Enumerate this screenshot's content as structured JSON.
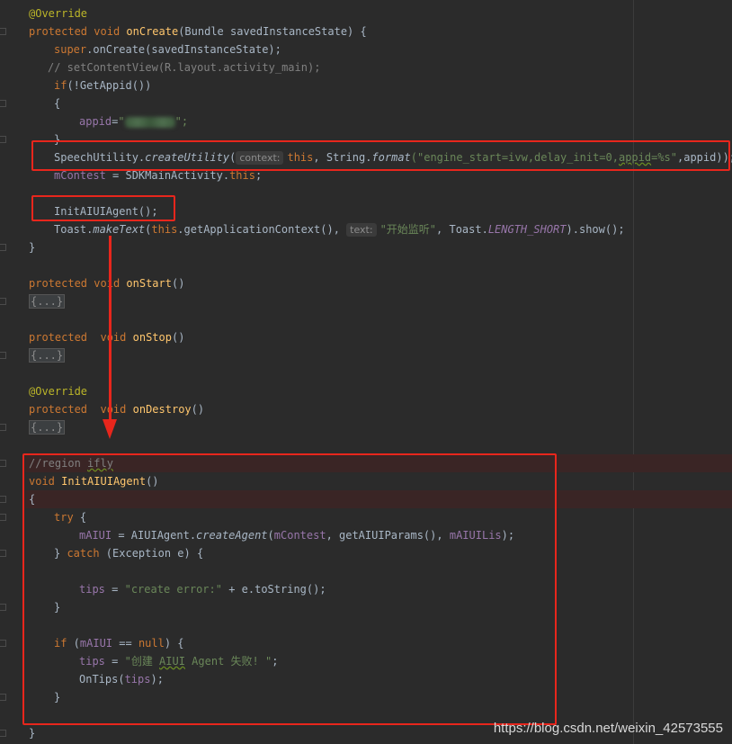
{
  "code_lines": {
    "l1_override": "@Override",
    "l2_protected": "protected",
    "l2_void": "void",
    "l2_method": "onCreate",
    "l2_rest": "(Bundle savedInstanceState) {",
    "l3_super": "super",
    "l3_rest": ".onCreate(savedInstanceState);",
    "l4_comment": "// setContentView(R.layout.activity_main);",
    "l5_if": "if",
    "l5_rest": "(!GetAppid())",
    "l6_brace": "{",
    "l7_field": "appid",
    "l7_eq": "=",
    "l7_q1": "\"",
    "l7_q2": "\";",
    "l8_brace": "}",
    "l9_class": "SpeechUtility.",
    "l9_method": "createUtility",
    "l9_paren": "(",
    "l9_hint": "context:",
    "l9_this": "this",
    "l9_comma": ", String.",
    "l9_format": "format",
    "l9_str_a": "(\"engine_start=ivw,delay_init=0,",
    "l9_str_squig": "appid",
    "l9_str_b": "=%s\"",
    "l9_end": ",appid));",
    "l10_field": "mContest",
    "l10_mid": " = SDKMainActivity.",
    "l10_this": "this",
    "l10_end": ";",
    "l12_call": "InitAIUIAgent();",
    "l13_toast": "Toast.",
    "l13_make": "makeText",
    "l13_paren": "(",
    "l13_this": "this",
    "l13_ctx": ".getApplicationContext(), ",
    "l13_hint": "text:",
    "l13_str": "\"开始监听\"",
    "l13_comma": ", Toast.",
    "l13_const": "LENGTH_SHORT",
    "l13_end": ").show();",
    "l14_brace": "}",
    "l16_protected": "protected",
    "l16_void": "void",
    "l16_method": "onStart",
    "l16_rest": "()",
    "l17_collapsed": "{...}",
    "l19_protected": "protected",
    "l19_void": "void",
    "l19_method": "onStop",
    "l19_rest": "()",
    "l20_collapsed": "{...}",
    "l22_override": "@Override",
    "l23_protected": "protected",
    "l23_void": "void",
    "l23_method": "onDestroy",
    "l23_rest": "()",
    "l24_collapsed": "{...}",
    "l26_comment_a": "//region ",
    "l26_comment_b": "ifly",
    "l27_void": "void",
    "l27_method": "InitAIUIAgent",
    "l27_rest": "()",
    "l28_brace": "{",
    "l29_try": "try",
    "l29_rest": " {",
    "l30_field": "mAIUI",
    "l30_mid": " = AIUIAgent.",
    "l30_method": "createAgent",
    "l30_paren": "(",
    "l30_field2": "mContest",
    "l30_mid2": ", getAIUIParams(), ",
    "l30_field3": "mAIUILis",
    "l30_end": ");",
    "l31_brace": "} ",
    "l31_catch": "catch",
    "l31_rest": " (Exception e) {",
    "l33_field": "tips",
    "l33_eq": " = ",
    "l33_str": "\"create error:\"",
    "l33_rest": " + e.toString();",
    "l34_brace": "}",
    "l36_if": "if",
    "l36_a": " (",
    "l36_field": "mAIUI",
    "l36_b": " == ",
    "l36_null": "null",
    "l36_c": ") {",
    "l37_field": "tips",
    "l37_eq": " = ",
    "l37_str_a": "\"创建 ",
    "l37_str_squig": "AIUI",
    "l37_str_b": " Agent 失败! \"",
    "l37_end": ";",
    "l38_call": "OnTips(",
    "l38_field": "tips",
    "l38_end": ");",
    "l39_brace": "}",
    "l41_brace": "}"
  },
  "watermark": "https://blog.csdn.net/weixin_42573555",
  "colors": {
    "background": "#2b2b2b",
    "keyword": "#cc7832",
    "annotation": "#bbb529",
    "string": "#6a8759",
    "field": "#9876aa",
    "method_decl": "#ffc66d",
    "comment": "#808080",
    "text": "#a9b7c6",
    "annotation_box": "#e8261c"
  }
}
